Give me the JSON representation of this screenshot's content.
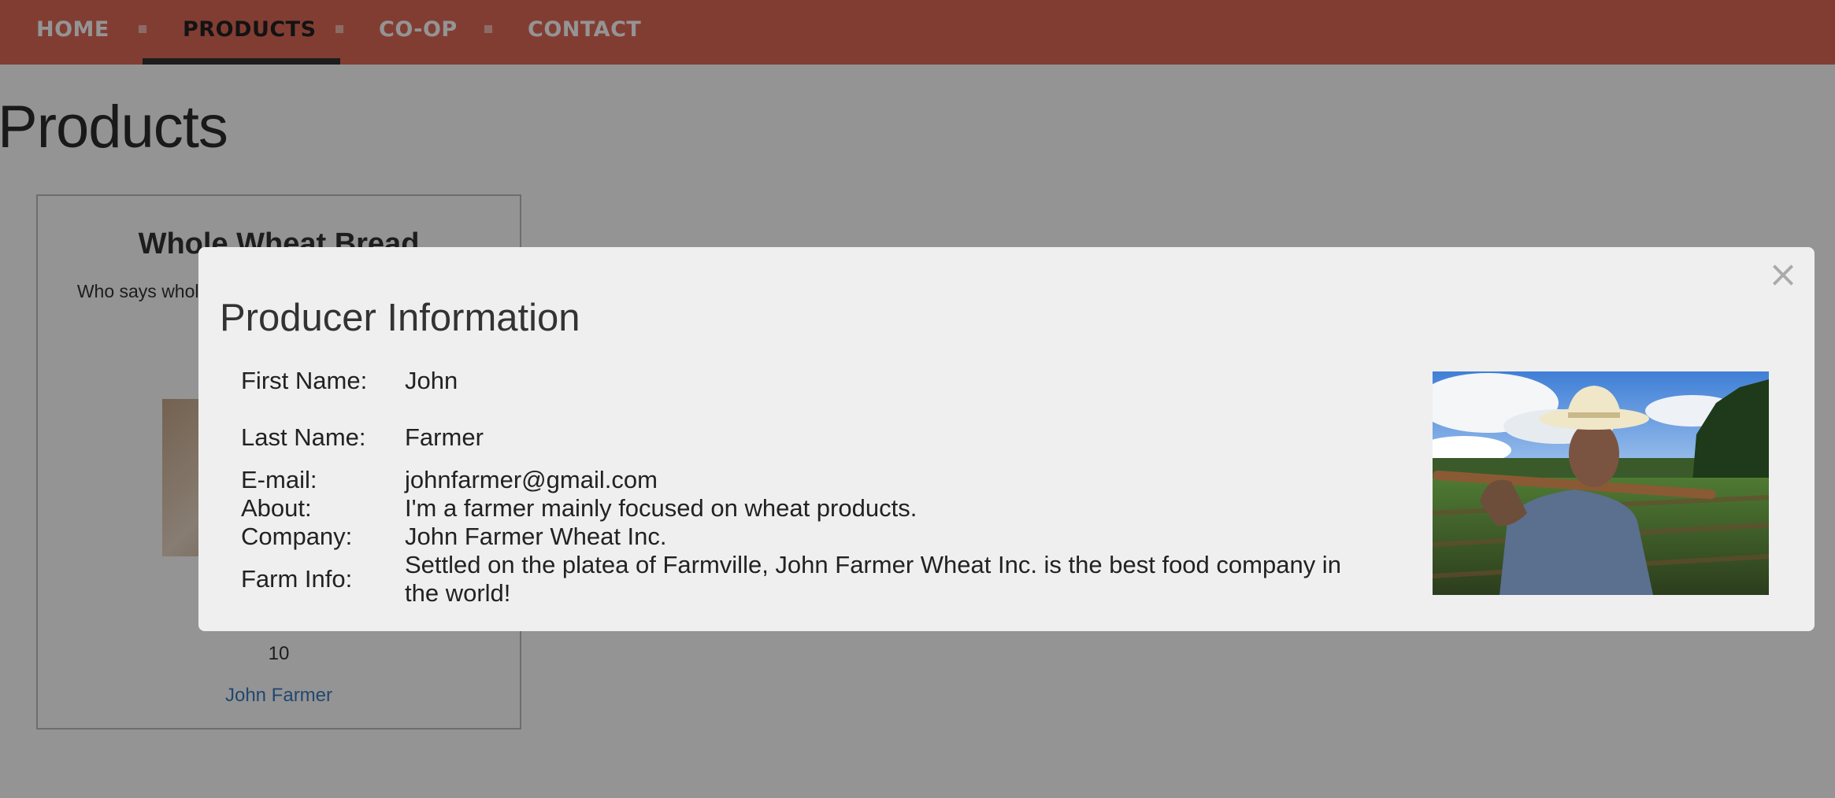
{
  "nav": {
    "items": [
      {
        "label": "HOME"
      },
      {
        "label": "PRODUCTS"
      },
      {
        "label": "CO-OP"
      },
      {
        "label": "CONTACT"
      }
    ],
    "active_index": 1,
    "bar_color": "#e06a58"
  },
  "page": {
    "title": "Products"
  },
  "product": {
    "title": "Whole Wheat Bread",
    "description": "Who says whole and tasteless features the de fine-grain",
    "quantity": "10",
    "producer_link": "John Farmer"
  },
  "modal": {
    "title": "Producer Information",
    "close_glyph": "×",
    "fields": [
      {
        "label": "First Name:",
        "value": "John"
      },
      {
        "label": "Last Name:",
        "value": "Farmer"
      },
      {
        "label": "E-mail:",
        "value": "johnfarmer@gmail.com"
      },
      {
        "label": "About:",
        "value": "I'm a farmer mainly focused on wheat products."
      },
      {
        "label": "Company:",
        "value": "John Farmer Wheat Inc."
      },
      {
        "label": "Farm Info:",
        "value": "Settled on the platea of Farmville, John Farmer Wheat Inc. is the best food company in the world!"
      }
    ]
  }
}
